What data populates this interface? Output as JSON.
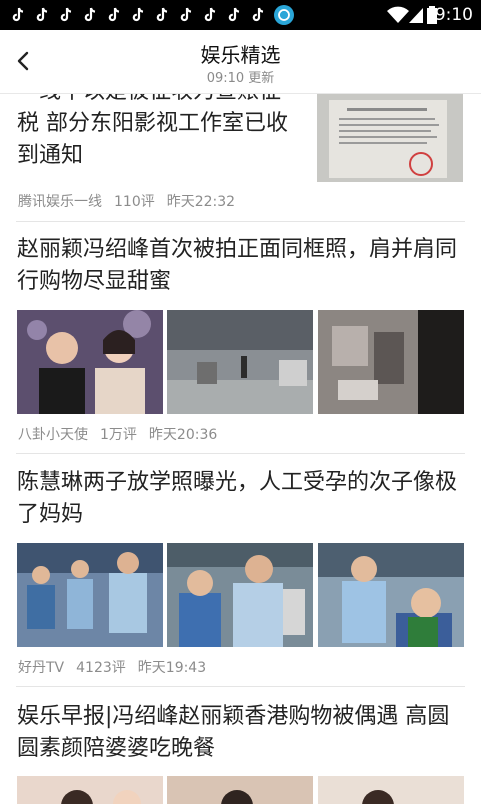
{
  "status_bar": {
    "time": "9:10",
    "notification_icons": [
      "tiktok-icon",
      "tiktok-icon",
      "tiktok-icon",
      "tiktok-icon",
      "tiktok-icon",
      "tiktok-icon",
      "tiktok-icon",
      "tiktok-icon",
      "tiktok-icon",
      "tiktok-icon",
      "app-icon"
    ]
  },
  "header": {
    "title": "娱乐精选",
    "subtitle": "09:10 更新"
  },
  "articles": [
    {
      "title": "一线中以是被征收为查账征税 部分东阳影视工作室已收到通知",
      "source": "腾讯娱乐一线",
      "comments": "110评",
      "time": "昨天22:32"
    },
    {
      "title": "赵丽颖冯绍峰首次被拍正面同框照，肩并肩同行购物尽显甜蜜",
      "source": "八卦小天使",
      "comments": "1万评",
      "time": "昨天20:36"
    },
    {
      "title": "陈慧琳两子放学照曝光，人工受孕的次子像极了妈妈",
      "source": "好丹TV",
      "comments": "4123评",
      "time": "昨天19:43"
    },
    {
      "title": "娱乐早报|冯绍峰赵丽颖香港购物被偶遇 高圆圆素颜陪婆婆吃晚餐"
    }
  ],
  "colors": {
    "status_bar": "#000000",
    "background": "#ffffff",
    "text": "#222222",
    "meta": "#8c8c8c"
  }
}
